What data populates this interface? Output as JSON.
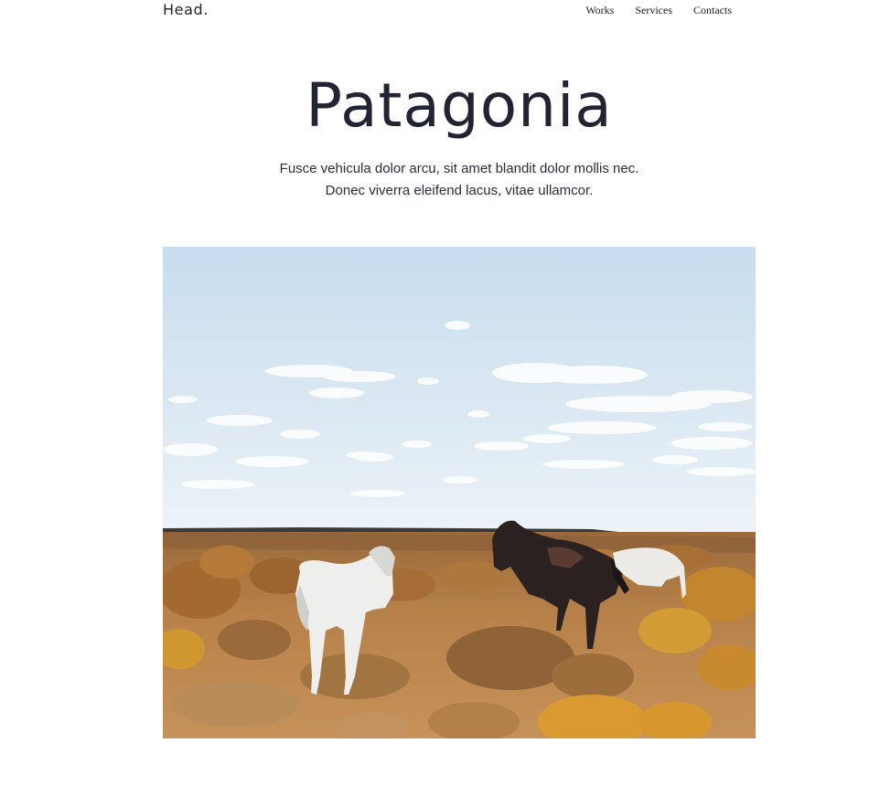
{
  "header": {
    "logo": "Head.",
    "nav": [
      "Works",
      "Services",
      "Contacts"
    ]
  },
  "hero": {
    "title": "Patagonia",
    "subtitle_line1": "Fusce vehicula dolor arcu, sit amet blandit dolor mollis nec.",
    "subtitle_line2": "Donec viverra eleifend lacus, vitae ullamcor."
  },
  "colors": {
    "text": "#222433",
    "sky_top": "#c9def0",
    "sky_bottom": "#e8f1f8",
    "grass": "#b8844a"
  }
}
